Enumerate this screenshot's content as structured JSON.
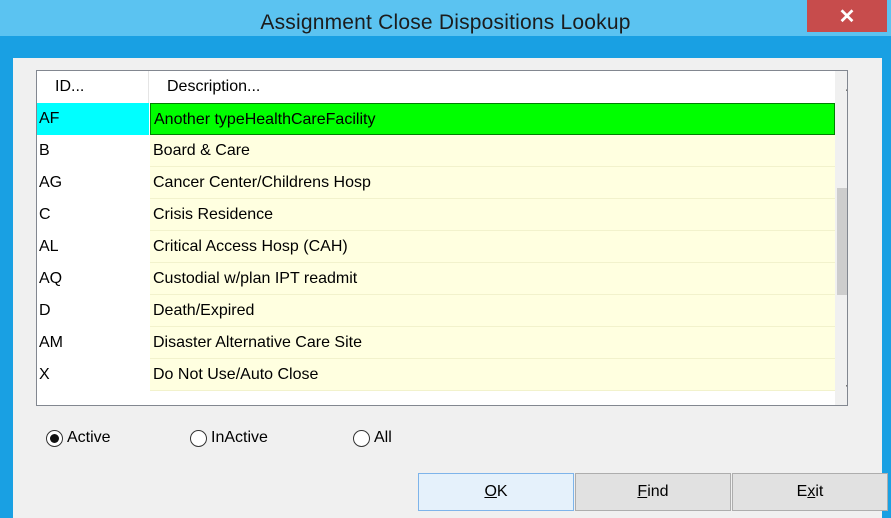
{
  "window": {
    "title": "Assignment Close Dispositions Lookup",
    "close_glyph": "✕"
  },
  "list": {
    "headers": {
      "id": "ID...",
      "description": "Description..."
    },
    "rows": [
      {
        "id": "AF",
        "description": "Another typeHealthCareFacility",
        "selected": true
      },
      {
        "id": "B",
        "description": "Board & Care"
      },
      {
        "id": "AG",
        "description": "Cancer Center/Childrens Hosp"
      },
      {
        "id": "C",
        "description": "Crisis Residence"
      },
      {
        "id": "AL",
        "description": "Critical Access Hosp (CAH)"
      },
      {
        "id": "AQ",
        "description": "Custodial w/plan IPT readmit"
      },
      {
        "id": "D",
        "description": "Death/Expired"
      },
      {
        "id": "AM",
        "description": "Disaster Alternative Care Site"
      },
      {
        "id": "X",
        "description": "Do Not Use/Auto Close"
      }
    ],
    "scrollbar": {
      "up_icon": "chevron-up-icon",
      "down_icon": "chevron-down-icon",
      "thumb_grip": "≡"
    }
  },
  "filters": {
    "options": [
      {
        "label": "Active",
        "checked": true
      },
      {
        "label": "InActive",
        "checked": false
      },
      {
        "label": "All",
        "checked": false
      }
    ]
  },
  "buttons": {
    "ok": {
      "access": "O",
      "rest": "K"
    },
    "find": {
      "access": "F",
      "rest": "ind"
    },
    "exit": {
      "pre": "E",
      "access": "x",
      "rest": "it"
    }
  },
  "colors": {
    "selected_id_bg": "#00ffff",
    "selected_desc_bg": "#00ff00",
    "row_bg": "#ffffe0",
    "close_button": "#c74c4c",
    "titlebar": "#5bc3f1"
  }
}
